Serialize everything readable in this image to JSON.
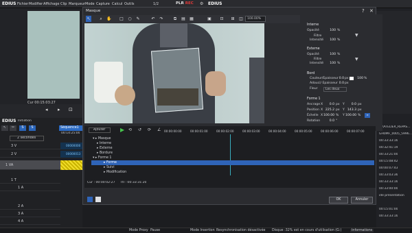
{
  "menubar": {
    "logo": "EDIUS",
    "items": [
      "Fichier",
      "Modifier",
      "Affichage",
      "Clip",
      "Marqueur",
      "Mode",
      "Capture",
      "Calcul",
      "Outils"
    ],
    "page_counter": "1/2",
    "plr_label": "PLR",
    "rec_label": "REC",
    "recorder_title": "EDIUS"
  },
  "player": {
    "timecode": "Cur 00:15:03:27",
    "view_color": "#a9c1bd"
  },
  "timeline": {
    "logo": "EDIUS",
    "mode": "Initiation",
    "sequence_tab": "Séquence1",
    "time_unit": "2 secondes",
    "timecode": "00:14:25:00",
    "tracks": [
      {
        "name": "3 V",
        "clip": "00000000"
      },
      {
        "name": "2 V",
        "clip": "00000013"
      },
      {
        "name": "1 VA",
        "clip": ""
      },
      {
        "name": "1 T",
        "clip": ""
      },
      {
        "name": "1 A",
        "clip": ""
      },
      {
        "name": "2 A",
        "clip": ""
      },
      {
        "name": "3 A",
        "clip": ""
      },
      {
        "name": "4 A",
        "clip": ""
      }
    ]
  },
  "dialog": {
    "title": "Masque",
    "zoom": "100.00%",
    "ajouter": "Ajouter",
    "ok_label": "OK",
    "cancel_label": "Annuler",
    "cur_time": "Cur : 00:00:02:27",
    "ttl_time": "TtI : 00:33:31:20",
    "ruler": [
      "00:00:00:00",
      "00:00:01:00",
      "00:00:02:00",
      "00:00:03:00",
      "00:00:04:00",
      "00:00:05:00",
      "00:00:06:00",
      "00:00:07:00"
    ],
    "tree": [
      "Masque",
      "Interne",
      "Externe",
      "Bordure",
      "Forme 1",
      "Forme",
      "Suivi",
      "Modification"
    ]
  },
  "props": {
    "interne": {
      "title": "Interne",
      "opacite_label": "Opacité",
      "opacite_value": "100",
      "unit": "%",
      "filtre_label": "Filtre",
      "intensite_label": "Intensité",
      "intensite_value": "100"
    },
    "externe": {
      "title": "Externe",
      "opacite_label": "Opacité",
      "opacite_value": "100",
      "unit": "%",
      "filtre_label": "Filtre",
      "intensite_label": "Intensité",
      "intensite_value": "100"
    },
    "bord": {
      "title": "Bord",
      "couleur_label": "Couleur/Epaisseur",
      "couleur_value": "0.0",
      "couleur_unit": "px",
      "couleur_pct": "100",
      "couleur_pct_unit": "%",
      "adouci_label": "Adouci/ Epaisseur",
      "adouci_value": "0.0",
      "adouci_unit": "px",
      "fleur_label": "Fleur",
      "fleur_value": "Les deux"
    },
    "forme": {
      "title": "Forme 1",
      "ancrage_label": "Ancrage",
      "ancrage_x": "0.0",
      "ancrage_y": "0.0",
      "position_label": "Position",
      "position_x": "225.2",
      "position_y": "143.3",
      "echelle_label": "Échelle",
      "echelle_x": "100.00",
      "echelle_y": "100.00",
      "rotation_label": "Rotation",
      "rotation_value": "0.0",
      "px_unit": "px",
      "pct_unit": "%",
      "deg_unit": "°",
      "x_label": "X",
      "y_label": "Y"
    }
  },
  "rightpanel": {
    "rows": [
      "G:\\ATELIER_REPAS...",
      "GH0MF_0005_5996...",
      "00:33:33:16",
      "00:32:41:19",
      "00:33:21:00",
      "00:15:08:42",
      "00:00:07:43",
      "00:33:03:36",
      "00:33:33:16",
      "00:33:00:00",
      "00:15:01:00",
      "00:33:33:16"
    ],
    "label": "ide présentation"
  },
  "footer": {
    "mode": "Mode Proxy",
    "pause": "Pause",
    "insertion": "Mode Insertion",
    "resync": "Resynchronisation désactivée",
    "disk": "Disque :32% est en cours d'utilisation (G:)",
    "info_tab": "Informations"
  },
  "colors": {
    "accent": "#2f64b8",
    "playhead": "#3ab0c0"
  }
}
